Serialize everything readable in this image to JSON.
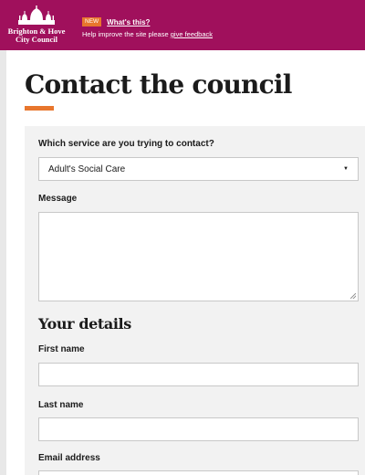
{
  "header": {
    "logo_line1": "Brighton & Hove",
    "logo_line2": "City Council",
    "badge": "NEW",
    "whats_this": "What's this?",
    "feedback_text": "Help improve the site please",
    "feedback_link": "give feedback",
    "brand_color": "#a0105c",
    "accent_color": "#e8762d"
  },
  "page": {
    "title": "Contact the council"
  },
  "form": {
    "service_label": "Which service are you trying to contact?",
    "service_value": "Adult's Social Care",
    "message_label": "Message",
    "message_value": "",
    "details_heading": "Your details",
    "first_name_label": "First name",
    "first_name_value": "",
    "last_name_label": "Last name",
    "last_name_value": "",
    "email_label": "Email address",
    "email_value": ""
  }
}
